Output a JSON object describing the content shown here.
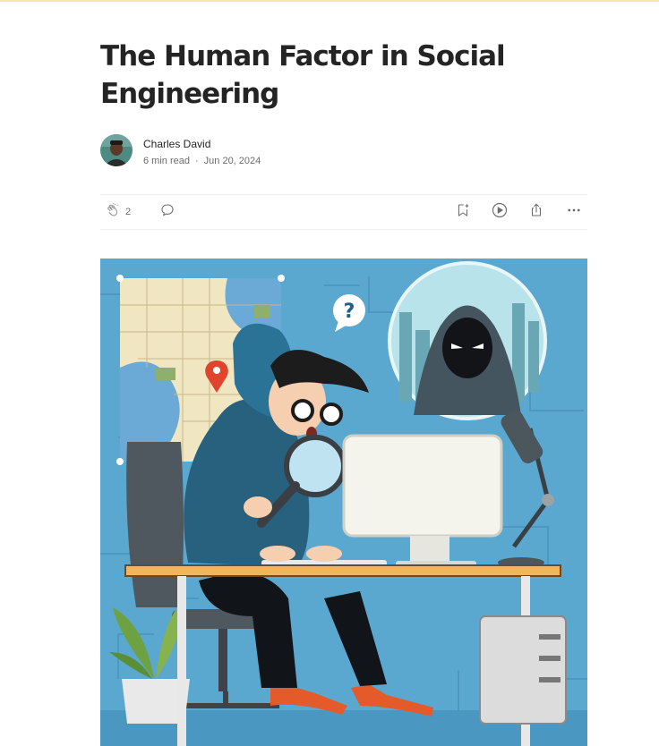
{
  "article": {
    "title": "The Human Factor in Social Engineering",
    "author": "Charles David",
    "read_time": "6 min read",
    "separator": "·",
    "date": "Jun 20, 2024"
  },
  "actions": {
    "clap_count": "2"
  },
  "icons": {
    "clap": "clap-icon",
    "comment": "comment-icon",
    "save": "bookmark-add-icon",
    "listen": "play-circle-icon",
    "share": "share-icon",
    "more": "more-horizontal-icon"
  },
  "colors": {
    "text": "#242424",
    "muted": "#6b6b6b",
    "divider": "#f0f0f0",
    "hero_background": "#5aa8cf"
  }
}
